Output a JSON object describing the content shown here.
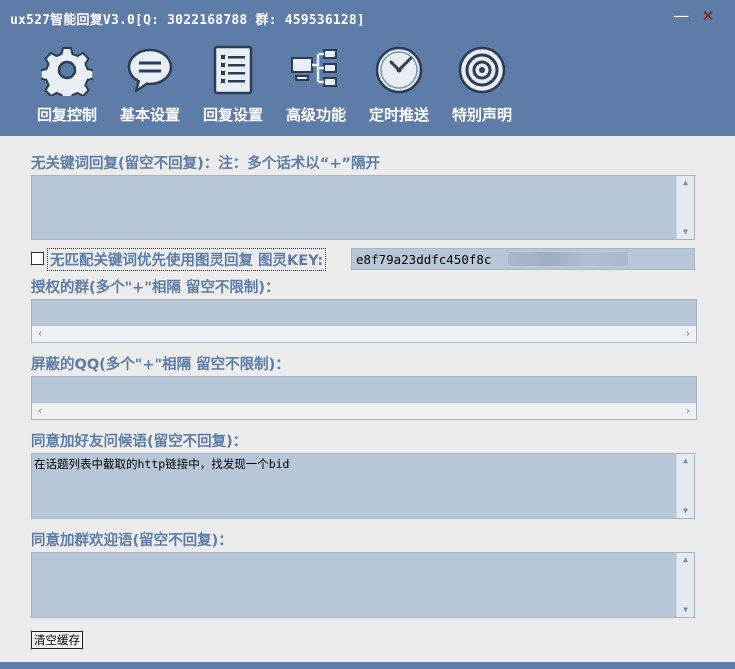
{
  "window": {
    "title": "ux527智能回复V3.0[Q: 3022168788 群: 459536128]",
    "minimize_glyph": "—",
    "close_glyph": "✕",
    "accent_color": "#5d7ca7",
    "field_color": "#b7c7d8"
  },
  "toolbar": [
    {
      "label": "回复控制",
      "icon": "gear-icon"
    },
    {
      "label": "基本设置",
      "icon": "chat-icon"
    },
    {
      "label": "回复设置",
      "icon": "list-icon"
    },
    {
      "label": "高级功能",
      "icon": "network-icon"
    },
    {
      "label": "定时推送",
      "icon": "clock-icon"
    },
    {
      "label": "特别声明",
      "icon": "target-icon"
    }
  ],
  "form": {
    "irrelevant_reply_label": "无关键词回复(留空不回复)：注：多个话术以“+”隔开",
    "irrelevant_reply_value": "",
    "tuling_checkbox_label": "无匹配关键词优先使用图灵回复 图灵KEY:",
    "tuling_checked": false,
    "tuling_key_value": "e8f79a23ddfc450f8c",
    "authorized_groups_label": "授权的群(多个\"+\"相隔 留空不限制)：",
    "authorized_groups_value": "",
    "blocked_qq_label": "屏蔽的QQ(多个\"+\"相隔 留空不限制)：",
    "blocked_qq_value": "",
    "friend_greeting_label": "同意加好友问候语(留空不回复)：",
    "friend_greeting_value": "在话题列表中截取的http链接中，找发现一个bid",
    "group_welcome_label": "同意加群欢迎语(留空不回复)：",
    "group_welcome_value": "",
    "clear_cache_label": "清空缓存"
  },
  "scroll_glyphs": {
    "up": "▲",
    "down": "▼",
    "left": "‹",
    "right": "›"
  }
}
